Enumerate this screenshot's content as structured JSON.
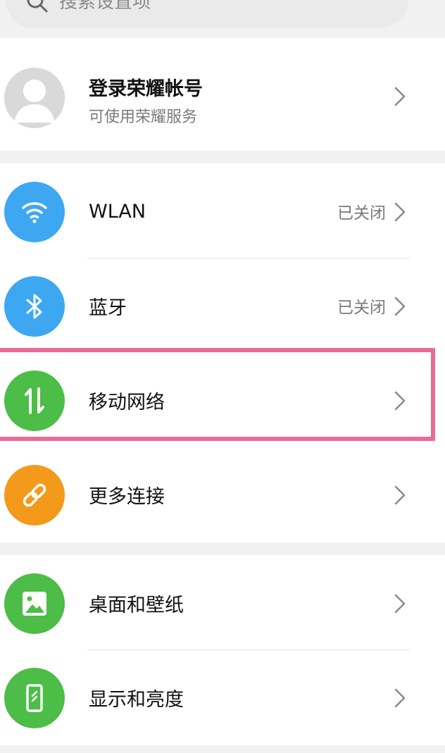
{
  "search": {
    "placeholder": "搜索设置项",
    "icon": "search-icon"
  },
  "account": {
    "title": "登录荣耀帐号",
    "subtitle": "可使用荣耀服务",
    "icon": "avatar-icon"
  },
  "connectivity": [
    {
      "key": "wlan",
      "label": "WLAN",
      "status": "已关闭",
      "icon": "wifi-icon",
      "color": "#3ea7f1"
    },
    {
      "key": "bluetooth",
      "label": "蓝牙",
      "status": "已关闭",
      "icon": "bluetooth-icon",
      "color": "#3ea7f1"
    },
    {
      "key": "mobile",
      "label": "移动网络",
      "status": "",
      "icon": "mobile-data-icon",
      "color": "#4cbd46",
      "highlighted": true
    },
    {
      "key": "more",
      "label": "更多连接",
      "status": "",
      "icon": "link-icon",
      "color": "#f49a1a"
    }
  ],
  "display": [
    {
      "key": "wallpaper",
      "label": "桌面和壁纸",
      "icon": "picture-icon",
      "color": "#4cbd46"
    },
    {
      "key": "brightness",
      "label": "显示和亮度",
      "icon": "phone-icon",
      "color": "#4cbd46"
    }
  ],
  "colors": {
    "highlight": "#ea6a98",
    "background": "#f1f1f1"
  }
}
